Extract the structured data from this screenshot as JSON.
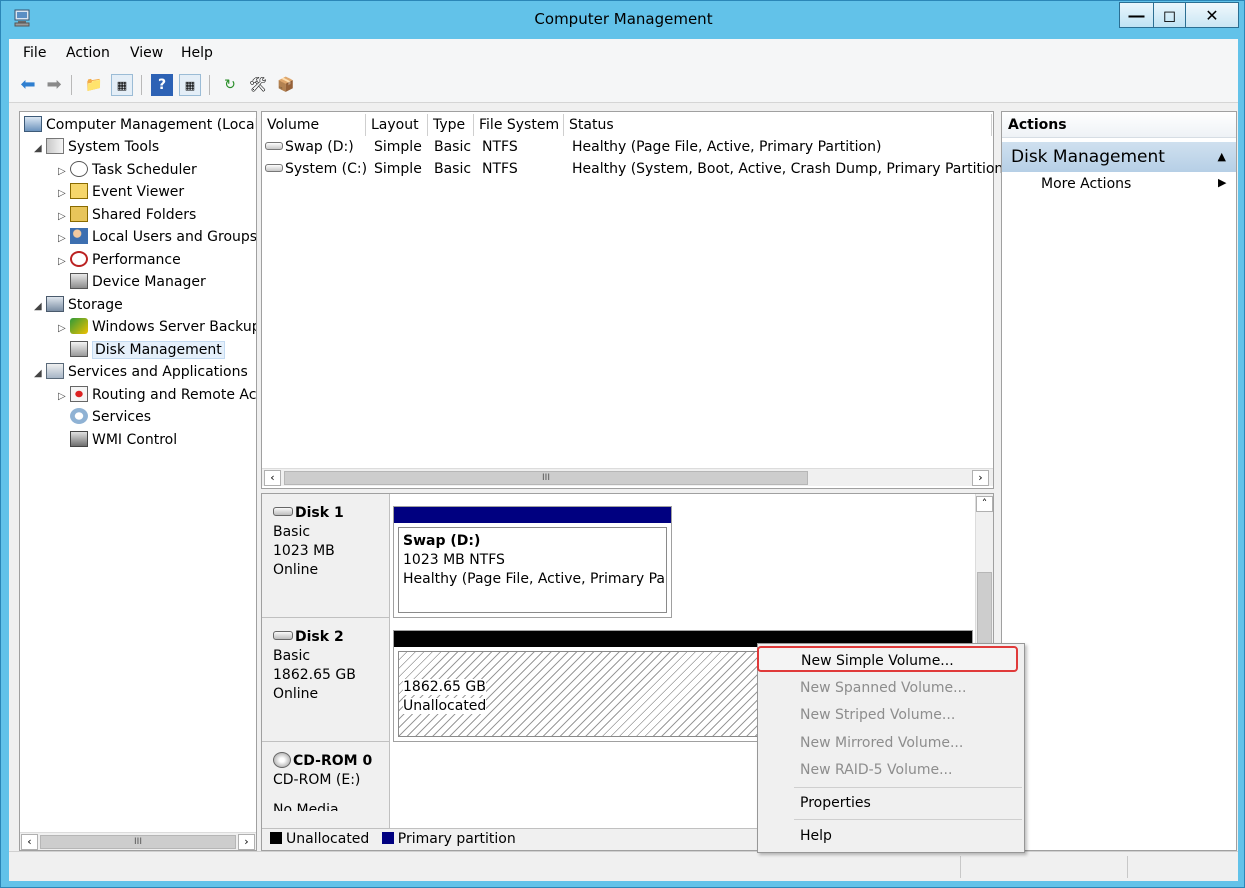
{
  "window": {
    "title": "Computer Management"
  },
  "menu": {
    "file": "File",
    "action": "Action",
    "view": "View",
    "help": "Help"
  },
  "tree": {
    "root": "Computer Management (Local",
    "system_tools": "System Tools",
    "task_scheduler": "Task Scheduler",
    "event_viewer": "Event Viewer",
    "shared_folders": "Shared Folders",
    "local_users": "Local Users and Groups",
    "performance": "Performance",
    "device_manager": "Device Manager",
    "storage": "Storage",
    "wsb": "Windows Server Backup",
    "disk_management": "Disk Management",
    "services_apps": "Services and Applications",
    "routing": "Routing and Remote Ac",
    "services": "Services",
    "wmi": "WMI Control"
  },
  "volumes": {
    "headers": {
      "volume": "Volume",
      "layout": "Layout",
      "type": "Type",
      "fs": "File System",
      "status": "Status"
    },
    "rows": [
      {
        "volume": "Swap (D:)",
        "layout": "Simple",
        "type": "Basic",
        "fs": "NTFS",
        "status": "Healthy (Page File, Active, Primary Partition)"
      },
      {
        "volume": "System (C:)",
        "layout": "Simple",
        "type": "Basic",
        "fs": "NTFS",
        "status": "Healthy (System, Boot, Active, Crash Dump, Primary Partition)"
      }
    ]
  },
  "disks": [
    {
      "name": "Disk 1",
      "kind": "Basic",
      "size": "1023 MB",
      "state": "Online",
      "part_title": "Swap  (D:)",
      "part_size": "1023 MB NTFS",
      "part_status": "Healthy (Page File, Active, Primary Part"
    },
    {
      "name": "Disk 2",
      "kind": "Basic",
      "size": "1862.65 GB",
      "state": "Online",
      "part_size": "1862.65 GB",
      "part_status": "Unallocated"
    },
    {
      "name": "CD-ROM 0",
      "kind": "CD-ROM (E:)",
      "state": "No Media"
    }
  ],
  "legend": {
    "unallocated": "Unallocated",
    "primary": "Primary partition"
  },
  "actions": {
    "header": "Actions",
    "section": "Disk Management",
    "more": "More Actions"
  },
  "context_menu": {
    "new_simple": "New Simple Volume...",
    "new_spanned": "New Spanned Volume...",
    "new_striped": "New Striped Volume...",
    "new_mirrored": "New Mirrored Volume...",
    "new_raid5": "New RAID-5 Volume...",
    "properties": "Properties",
    "help": "Help"
  },
  "colors": {
    "primary_partition": "#000080",
    "unallocated": "#000000",
    "highlight": "#e03a3a",
    "titlebar": "#62c2e9"
  }
}
